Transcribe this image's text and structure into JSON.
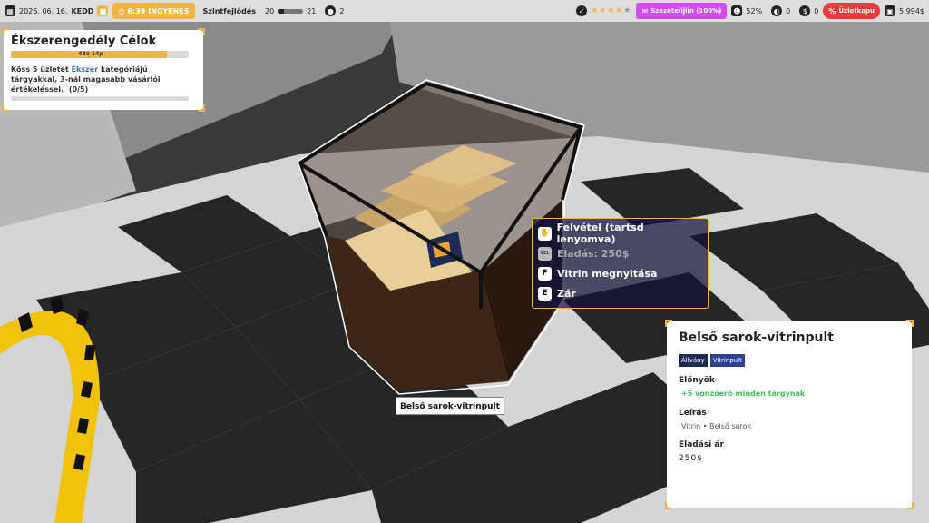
{
  "hud": {
    "date": "2026. 06. 16.",
    "weekday": "KEDD",
    "time": "6:39",
    "time_status": "INGYENES",
    "progress_label": "Szintfejlődés",
    "level_current": "20",
    "level_next": "21",
    "level_progress": 0.25,
    "staff_count": "2",
    "rating_stars": 4,
    "promo_label": "Szezetelijlin (100%)",
    "stat_percent": "52%",
    "stat_a": "0",
    "stat_b": "0",
    "sale_label": "Üzletkapu",
    "money": "5.994$",
    "colors": {
      "accent": "#f0b445",
      "promo": "#d04cf0",
      "sale": "#e43b3b"
    },
    "icons": [
      "calendar-icon",
      "clock-icon",
      "staff-icon",
      "rating-badge-icon",
      "promo-icon",
      "customer-icon",
      "thief-icon",
      "money-bag-icon",
      "discount-icon",
      "wallet-icon"
    ]
  },
  "quest": {
    "title": "Ékszerengedély Célok",
    "timer": "43ó 14p",
    "timer_progress": 0.88,
    "desc_before": "Köss 5 üzletet ",
    "desc_highlight": "Ékszer",
    "desc_after": " kategóriájú tárgyakkal, 3-nál magasabb vásárlói értékeléssel.",
    "progress_text": "(0/5)"
  },
  "prompts": [
    {
      "key": "✋",
      "label": "Felvétel (tartsd lenyomva)",
      "enabled": true,
      "icon": "hand-icon"
    },
    {
      "key": "SEL",
      "label": "Eladás: 250$",
      "enabled": false,
      "icon": "sell-key-icon"
    },
    {
      "key": "F",
      "label": "Vitrin megnyitása",
      "enabled": true,
      "icon": "f-key-icon"
    },
    {
      "key": "E",
      "label": "Zár",
      "enabled": true,
      "icon": "e-key-icon"
    }
  ],
  "object_tag": "Belső sarok-vitrinpult",
  "info": {
    "title": "Belső sarok-vitrinpult",
    "tags": [
      "Állvány",
      "Vitrinpult"
    ],
    "benefits_heading": "Előnyök",
    "benefit": "+5 vonzóerő minden tárgynak",
    "desc_heading": "Leírás",
    "desc": "Vitrin • Belső sarok",
    "price_heading": "Eladási ár",
    "price": "250$"
  }
}
